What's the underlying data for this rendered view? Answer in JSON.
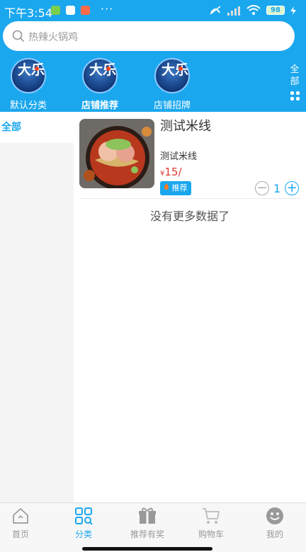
{
  "status_bar": {
    "time": "下午3:54",
    "battery": "98"
  },
  "search": {
    "placeholder": "热辣火锅鸡"
  },
  "categories": [
    {
      "label": "默认分类",
      "logo_text": "大乐"
    },
    {
      "label": "店铺推荐",
      "logo_text": "大乐"
    },
    {
      "label": "店铺招牌",
      "logo_text": "大乐"
    }
  ],
  "active_category": "店铺推荐",
  "all_button": {
    "label_line1": "全",
    "label_line2": "部"
  },
  "sidebar": {
    "items": [
      {
        "label": "全部"
      }
    ]
  },
  "product": {
    "name": "测试米线",
    "description": "测试米线",
    "currency": "¥",
    "price": "15",
    "unit_suffix": "/",
    "tag": "推荐",
    "quantity": "1"
  },
  "list_end_text": "没有更多数据了",
  "tabbar": {
    "items": [
      {
        "label": "首页",
        "icon": "home-icon"
      },
      {
        "label": "分类",
        "icon": "category-grid-icon"
      },
      {
        "label": "推荐有奖",
        "icon": "gift-icon"
      },
      {
        "label": "购物车",
        "icon": "cart-icon"
      },
      {
        "label": "我的",
        "icon": "smiley-icon"
      }
    ],
    "active": "分类"
  },
  "colors": {
    "primary": "#1aa7ee",
    "price": "#e03b32"
  }
}
